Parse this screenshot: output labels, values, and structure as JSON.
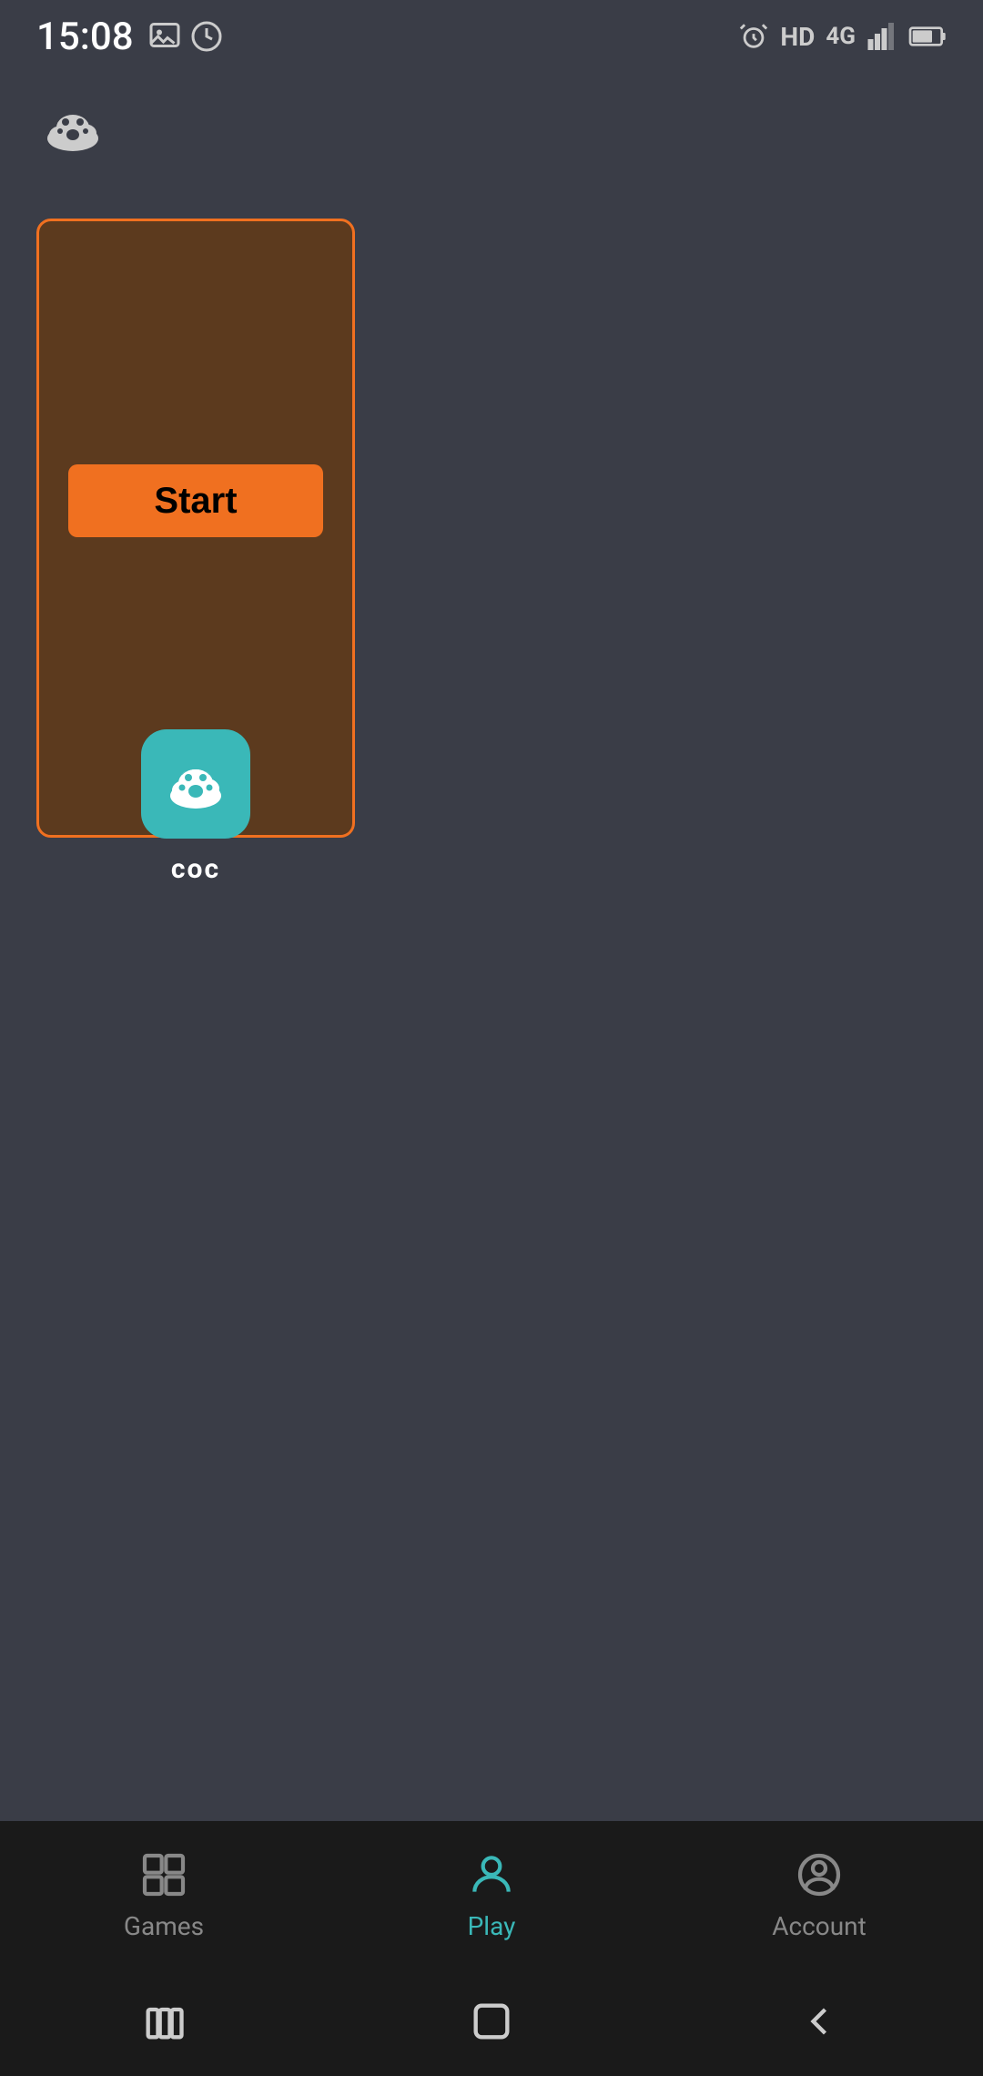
{
  "statusBar": {
    "time": "15:08",
    "leftIcons": [
      "image-icon",
      "clock-icon"
    ],
    "rightIcons": [
      "alarm-icon",
      "hd-label",
      "4g-label",
      "signal-icon",
      "battery-icon"
    ]
  },
  "header": {
    "logoAlt": "paw-cloud-logo"
  },
  "gameCard": {
    "startButtonLabel": "Start",
    "gameName": "coc",
    "gameIconAlt": "coc-icon"
  },
  "bottomNav": {
    "items": [
      {
        "id": "games",
        "label": "Games",
        "active": false
      },
      {
        "id": "play",
        "label": "Play",
        "active": true
      },
      {
        "id": "account",
        "label": "Account",
        "active": false
      }
    ]
  },
  "systemNav": {
    "buttons": [
      "recents",
      "home",
      "back"
    ]
  }
}
